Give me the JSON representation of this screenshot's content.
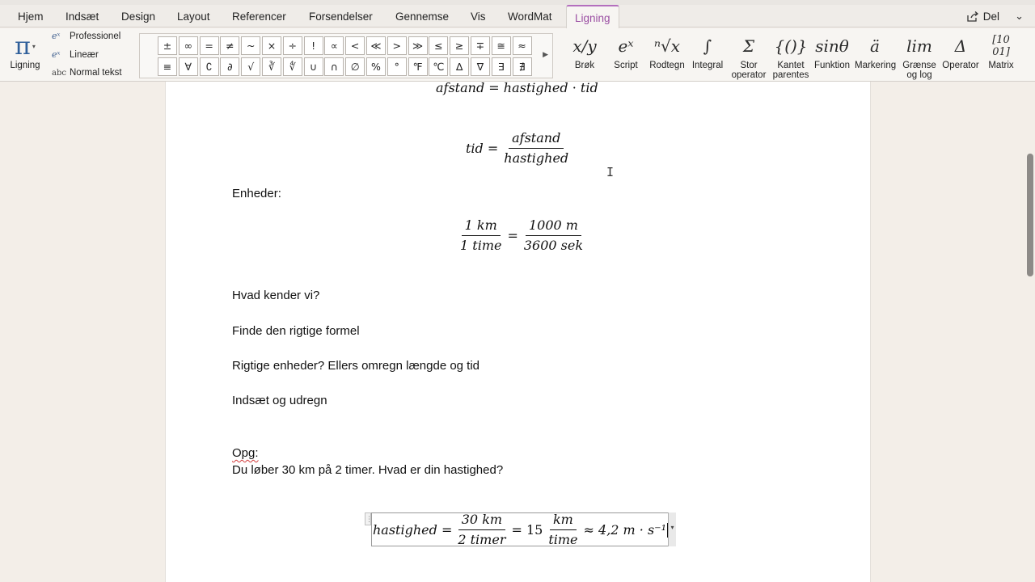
{
  "tabs": [
    "Hjem",
    "Indsæt",
    "Design",
    "Layout",
    "Referencer",
    "Forsendelser",
    "Gennemse",
    "Vis",
    "WordMat",
    "Ligning"
  ],
  "share_label": "Del",
  "ribbon": {
    "equation_label": "Ligning",
    "conversions": [
      "Professionel",
      "Lineær",
      "Normal tekst"
    ],
    "symbols": [
      "±",
      "∞",
      "=",
      "≠",
      "~",
      "×",
      "÷",
      "!",
      "∝",
      "<",
      "≪",
      ">",
      "≫",
      "≤",
      "≥",
      "∓",
      "≅",
      "≈",
      "≡",
      "∀",
      "∁",
      "∂",
      "√",
      "∛",
      "∜",
      "∪",
      "∩",
      "∅",
      "%",
      "°",
      "℉",
      "℃",
      "∆",
      "∇",
      "∃",
      "∄"
    ],
    "structures": [
      {
        "glyph": "x/y",
        "label": "Brøk"
      },
      {
        "glyph": "eˣ",
        "label": "Script"
      },
      {
        "glyph": "ⁿ√x",
        "label": "Rodtegn"
      },
      {
        "glyph": "∫",
        "label": "Integral"
      },
      {
        "glyph": "Σ",
        "label": "Stor operator"
      },
      {
        "glyph": "{()}",
        "label": "Kantet parentes"
      },
      {
        "glyph": "sinθ",
        "label": "Funktion"
      },
      {
        "glyph": "ä",
        "label": "Markering"
      },
      {
        "glyph": "lim",
        "label": "Grænse og log"
      },
      {
        "glyph": "Δ",
        "label": "Operator"
      },
      {
        "glyph": "[10 01]",
        "label": "Matrix"
      }
    ]
  },
  "doc": {
    "eq1": {
      "lhs": "afstand",
      "op": "=",
      "a": "hastighed",
      "dot": "·",
      "b": "tid"
    },
    "eq2": {
      "lhs": "tid",
      "op": "=",
      "num": "afstand",
      "den": "hastighed"
    },
    "units_heading": "Enheder:",
    "eq3": {
      "num1": "1 km",
      "den1": "1 time",
      "op": "=",
      "num2": "1000 m",
      "den2": "3600 sek"
    },
    "steps": [
      "Hvad kender vi?",
      "Finde den rigtige formel",
      "Rigtige enheder? Ellers omregn længde og tid",
      "Indsæt og udregn"
    ],
    "task_label": "Opg:",
    "task_text": "Du løber 30 km på 2 timer. Hvad er din hastighed?",
    "eq4": {
      "lhs": "hastighed",
      "op": "=",
      "num1": "30 km",
      "den1": "2 timer",
      "op2": "= 15",
      "num2": "km",
      "den2": "time",
      "approx": "≈ 4,2 m · s⁻¹"
    }
  }
}
